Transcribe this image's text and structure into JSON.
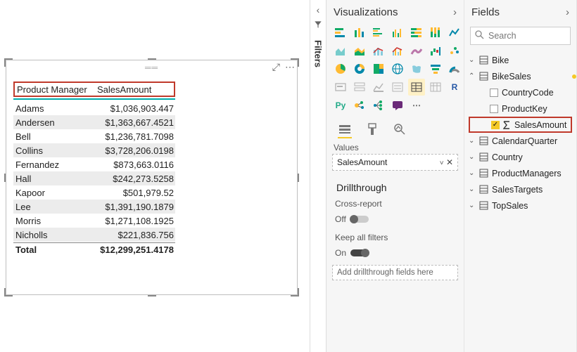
{
  "filters_label": "Filters",
  "panes": {
    "viz": {
      "title": "Visualizations"
    },
    "fields": {
      "title": "Fields",
      "search_placeholder": "Search"
    }
  },
  "table": {
    "col1": "Product Manager",
    "col2": "SalesAmount",
    "rows": [
      {
        "pm": "Adams",
        "amt": "$1,036,903.447"
      },
      {
        "pm": "Andersen",
        "amt": "$1,363,667.4521"
      },
      {
        "pm": "Bell",
        "amt": "$1,236,781.7098"
      },
      {
        "pm": "Collins",
        "amt": "$3,728,206.0198"
      },
      {
        "pm": "Fernandez",
        "amt": "$873,663.0116"
      },
      {
        "pm": "Hall",
        "amt": "$242,273.5258"
      },
      {
        "pm": "Kapoor",
        "amt": "$501,979.52"
      },
      {
        "pm": "Lee",
        "amt": "$1,391,190.1879"
      },
      {
        "pm": "Morris",
        "amt": "$1,271,108.1925"
      },
      {
        "pm": "Nicholls",
        "amt": "$221,836.756"
      }
    ],
    "total_label": "Total",
    "total_amt": "$12,299,251.4178"
  },
  "values": {
    "label": "Values",
    "field": "SalesAmount"
  },
  "drill": {
    "heading": "Drillthrough",
    "cross": "Cross-report",
    "off": "Off",
    "keep": "Keep all filters",
    "on": "On",
    "drop": "Add drillthrough fields here"
  },
  "field_tree": {
    "bike": "Bike",
    "bikesales": "BikeSales",
    "countrycode": "CountryCode",
    "productkey": "ProductKey",
    "salesamount": "SalesAmount",
    "calendarquarter": "CalendarQuarter",
    "country": "Country",
    "productmanagers": "ProductManagers",
    "salestargets": "SalesTargets",
    "topsales": "TopSales"
  }
}
